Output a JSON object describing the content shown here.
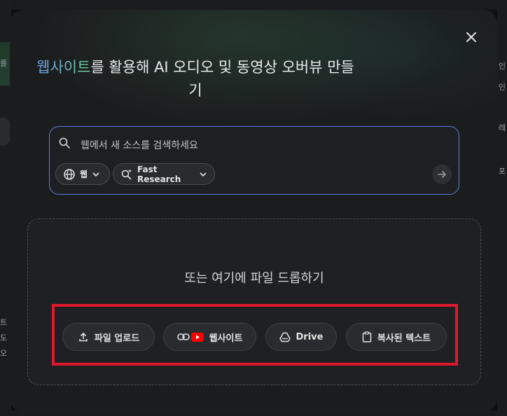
{
  "background": {
    "left_fragments": [
      "를",
      "~",
      "·",
      "트",
      "도",
      "오"
    ],
    "right_fragments": [
      "·",
      "인",
      "인",
      "레",
      "포",
      "·"
    ]
  },
  "modal": {
    "title_highlight": "웹사이트",
    "title_line1_rest": "를 활용해 AI 오디오 및 동영상 오버뷰 만들",
    "title_line2": "기",
    "search": {
      "placeholder": "웹에서 새 소스를 검색하세요",
      "chip_source": "웹",
      "chip_mode": "Fast Research"
    },
    "drop_zone": {
      "text": "또는 여기에 파일 드롭하기",
      "buttons": {
        "upload": "파일 업로드",
        "website": "웹사이트",
        "drive": "Drive",
        "copied_text": "복사된 텍스트"
      }
    }
  },
  "colors": {
    "accent_border": "#5b7fe0",
    "highlight_box": "#e0182d",
    "youtube_red": "#ff0000"
  }
}
